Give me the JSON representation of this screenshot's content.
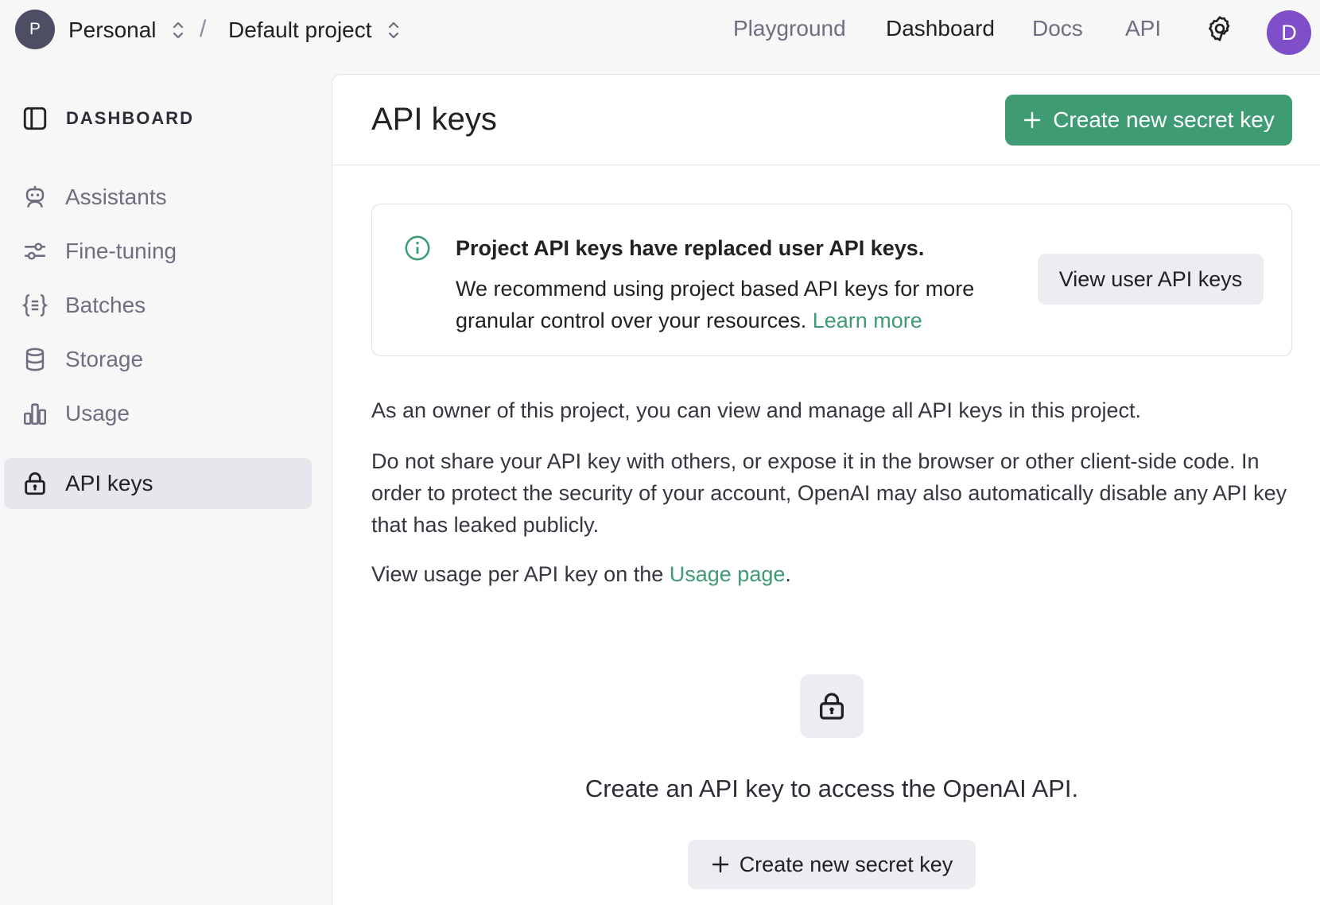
{
  "topbar": {
    "org_initial": "P",
    "org_name": "Personal",
    "separator": "/",
    "project_name": "Default project",
    "nav": [
      "Playground",
      "Dashboard",
      "Docs",
      "API"
    ],
    "active_nav": "Dashboard",
    "user_initial": "D"
  },
  "sidebar": {
    "header": "DASHBOARD",
    "items": [
      {
        "label": "Assistants",
        "icon": "robot-icon"
      },
      {
        "label": "Fine-tuning",
        "icon": "sliders-icon"
      },
      {
        "label": "Batches",
        "icon": "braces-icon"
      },
      {
        "label": "Storage",
        "icon": "database-icon"
      },
      {
        "label": "Usage",
        "icon": "bar-chart-icon"
      },
      {
        "label": "API keys",
        "icon": "lock-icon"
      }
    ],
    "active_item": "API keys"
  },
  "main": {
    "title": "API keys",
    "create_button": "Create new secret key",
    "notice": {
      "title": "Project API keys have replaced user API keys.",
      "body": "We recommend using project based API keys for more granular control over your resources. ",
      "link": "Learn more",
      "button": "View user API keys"
    },
    "paragraph_owner": "As an owner of this project, you can view and manage all API keys in this project.",
    "paragraph_warning": "Do not share your API key with others, or expose it in the browser or other client-side code. In order to protect the security of your account, OpenAI may also automatically disable any API key that has leaked publicly.",
    "usage_prefix": "View usage per API key on the ",
    "usage_link": "Usage page",
    "usage_suffix": ".",
    "empty_state": {
      "title": "Create an API key to access the OpenAI API.",
      "button": "Create new secret key"
    }
  },
  "colors": {
    "accent": "#3f9b72",
    "user_avatar": "#7e4fc8",
    "org_avatar": "#4d4d63",
    "sidebar_active": "#e6e6ec"
  }
}
